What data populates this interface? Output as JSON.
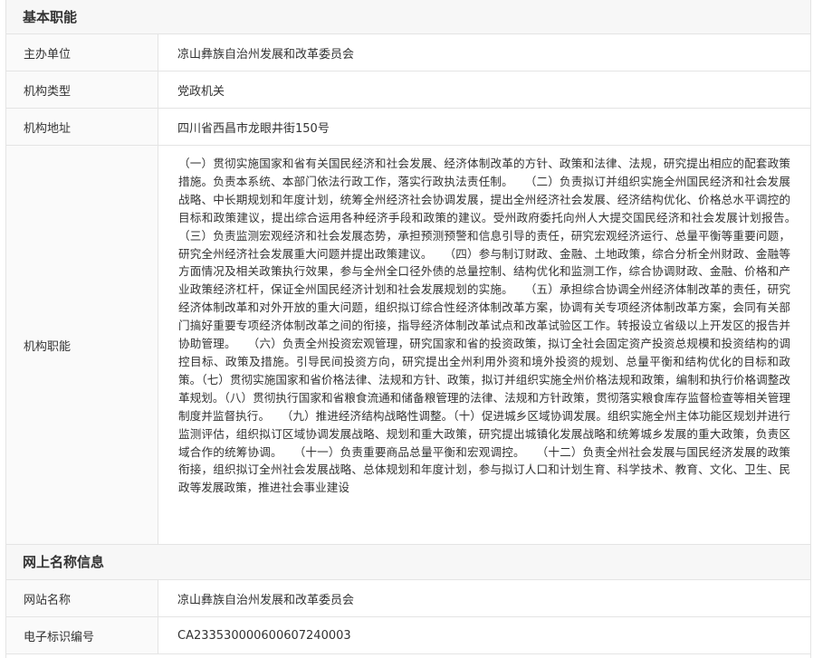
{
  "section_basic": {
    "title": "基本职能"
  },
  "rows": [
    {
      "label": "主办单位",
      "value": "凉山彝族自治州发展和改革委员会"
    },
    {
      "label": "机构类型",
      "value": "党政机关"
    },
    {
      "label": "机构地址",
      "value": "四川省西昌市龙眼井街150号"
    },
    {
      "label": "机构职能",
      "value": "（一）贯彻实施国家和省有关国民经济和社会发展、经济体制改革的方针、政策和法律、法规，研究提出相应的配套政策措施。负责本系统、本部门依法行政工作，落实行政执法责任制。　　（二）负责拟订并组织实施全州国民经济和社会发展战略、中长期规划和年度计划，统筹全州经济社会协调发展，提出全州经济社会发展、经济结构优化、价格总水平调控的目标和政策建议，提出综合运用各种经济手段和政策的建议。受州政府委托向州人大提交国民经济和社会发展计划报告。　　（三）负责监测宏观经济和社会发展态势，承担预测预警和信息引导的责任，研究宏观经济运行、总量平衡等重要问题，研究全州经济社会发展重大问题并提出政策建议。　　（四）参与制订财政、金融、土地政策，综合分析全州财政、金融等方面情况及相关政策执行效果，参与全州全口径外债的总量控制、结构优化和监测工作，综合协调财政、金融、价格和产业政策经济杠杆，保证全州国民经济计划和社会发展规划的实施。　　（五）承担综合协调全州经济体制改革的责任，研究经济体制改革和对外开放的重大问题，组织拟订综合性经济体制改革方案，协调有关专项经济体制改革方案，会同有关部门搞好重要专项经济体制改革之间的衔接，指导经济体制改革试点和改革试验区工作。转报设立省级以上开发区的报告并协助管理。　　（六）负责全州投资宏观管理，研究国家和省的投资政策，拟订全社会固定资产投资总规模和投资结构的调控目标、政策及措施。引导民间投资方向，研究提出全州利用外资和境外投资的规划、总量平衡和结构优化的目标和政策。（七）贯彻实施国家和省价格法律、法规和方针、政策，拟订并组织实施全州价格法规和政策，编制和执行价格调整改革规划。（八）贯彻执行国家和省粮食流通和储备粮管理的法律、法规和方针政策，贯彻落实粮食库存监督检查等相关管理制度并监督执行。　　（九）推进经济结构战略性调整。（十）促进城乡区域协调发展。组织实施全州主体功能区规划并进行监测评估，组织拟订区域协调发展战略、规划和重大政策，研究提出城镇化发展战略和统筹城乡发展的重大政策，负责区域合作的统筹协调。　　（十一）负责重要商品总量平衡和宏观调控。　　（十二）负责全州社会发展与国民经济发展的政策衔接，组织拟订全州社会发展战略、总体规划和年度计划，参与拟订人口和计划生育、科学技术、教育、文化、卫生、民政等发展政策，推进社会事业建设"
    }
  ],
  "section_web": {
    "title": "网上名称信息"
  },
  "web_rows": [
    {
      "label": "网站名称",
      "value": "凉山彝族自治州发展和改革委员会"
    },
    {
      "label": "电子标识编号",
      "value": "CA233530000600607240003"
    }
  ]
}
